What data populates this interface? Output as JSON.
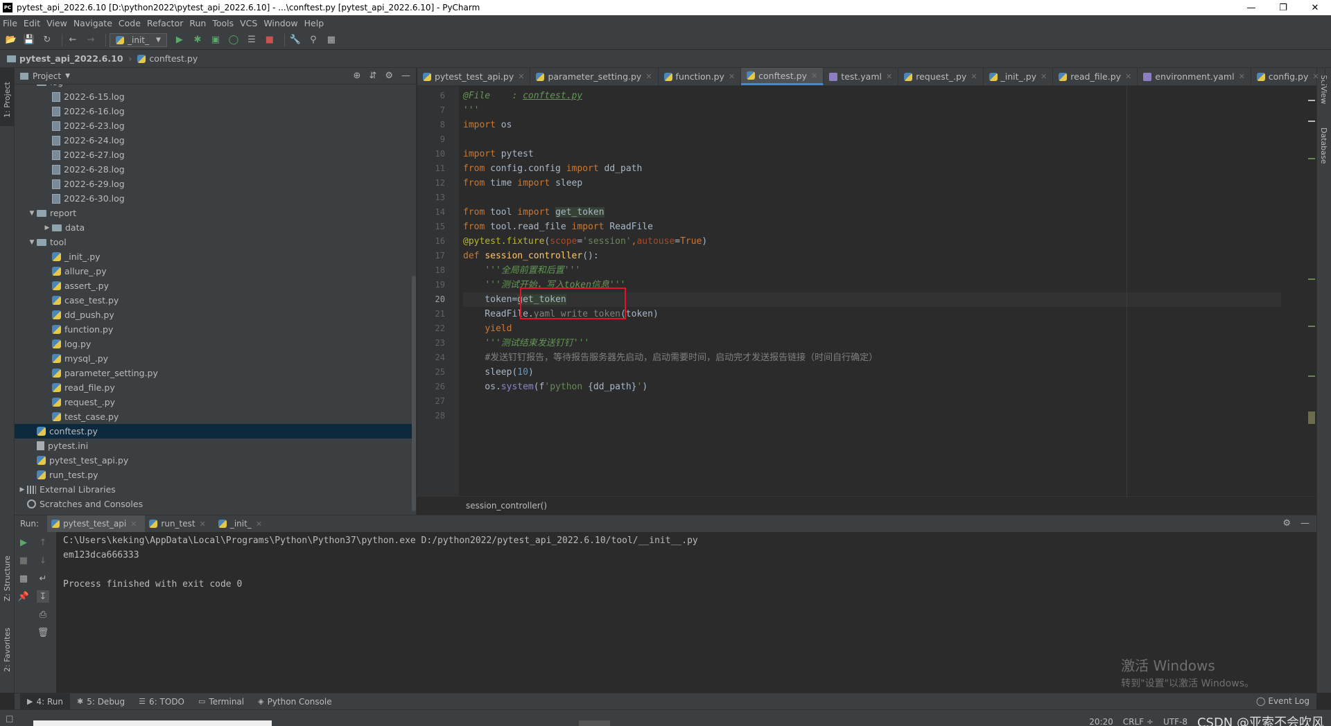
{
  "window": {
    "title": "pytest_api_2022.6.10 [D:\\python2022\\pytest_api_2022.6.10] - ...\\conftest.py [pytest_api_2022.6.10] - PyCharm",
    "logo": "PC",
    "controls": [
      "minimize-icon",
      "maximize-icon",
      "close-icon"
    ]
  },
  "menu": {
    "items": [
      "File",
      "Edit",
      "View",
      "Navigate",
      "Code",
      "Refactor",
      "Run",
      "Tools",
      "VCS",
      "Window",
      "Help"
    ]
  },
  "toolbar": {
    "run_config": "_init_",
    "icons": [
      "open-icon",
      "save-icon",
      "sync-icon",
      "back-icon",
      "forward-icon",
      "run-icon",
      "debug-icon",
      "coverage-icon",
      "profile-icon",
      "concurrency-icon",
      "stop-icon",
      "wrench-icon",
      "search-icon",
      "vcs-icon"
    ]
  },
  "navbar": {
    "project": "pytest_api_2022.6.10",
    "file": "conftest.py"
  },
  "left_strip": {
    "project": "1: Project",
    "structure": "Z: Structure",
    "favorites": "2: Favorites"
  },
  "right_strip": {
    "sciview": "SciView",
    "database": "Database"
  },
  "project_panel": {
    "title": "Project",
    "tree": [
      {
        "depth": 1,
        "arrow": "v",
        "icon": "folder",
        "label": "log"
      },
      {
        "depth": 2,
        "arrow": "",
        "icon": "log",
        "label": "2022-6-15.log"
      },
      {
        "depth": 2,
        "arrow": "",
        "icon": "log",
        "label": "2022-6-16.log"
      },
      {
        "depth": 2,
        "arrow": "",
        "icon": "log",
        "label": "2022-6-23.log"
      },
      {
        "depth": 2,
        "arrow": "",
        "icon": "log",
        "label": "2022-6-24.log"
      },
      {
        "depth": 2,
        "arrow": "",
        "icon": "log",
        "label": "2022-6-27.log"
      },
      {
        "depth": 2,
        "arrow": "",
        "icon": "log",
        "label": "2022-6-28.log"
      },
      {
        "depth": 2,
        "arrow": "",
        "icon": "log",
        "label": "2022-6-29.log"
      },
      {
        "depth": 2,
        "arrow": "",
        "icon": "log",
        "label": "2022-6-30.log"
      },
      {
        "depth": 1,
        "arrow": "v",
        "icon": "folder",
        "label": "report"
      },
      {
        "depth": 2,
        "arrow": ">",
        "icon": "folder",
        "label": "data"
      },
      {
        "depth": 1,
        "arrow": "v",
        "icon": "folder",
        "label": "tool"
      },
      {
        "depth": 2,
        "arrow": "",
        "icon": "py",
        "label": "_init_.py"
      },
      {
        "depth": 2,
        "arrow": "",
        "icon": "py",
        "label": "allure_.py"
      },
      {
        "depth": 2,
        "arrow": "",
        "icon": "py",
        "label": "assert_.py"
      },
      {
        "depth": 2,
        "arrow": "",
        "icon": "py",
        "label": "case_test.py"
      },
      {
        "depth": 2,
        "arrow": "",
        "icon": "py",
        "label": "dd_push.py"
      },
      {
        "depth": 2,
        "arrow": "",
        "icon": "py",
        "label": "function.py"
      },
      {
        "depth": 2,
        "arrow": "",
        "icon": "py",
        "label": "log.py"
      },
      {
        "depth": 2,
        "arrow": "",
        "icon": "py",
        "label": "mysql_.py"
      },
      {
        "depth": 2,
        "arrow": "",
        "icon": "py",
        "label": "parameter_setting.py"
      },
      {
        "depth": 2,
        "arrow": "",
        "icon": "py",
        "label": "read_file.py"
      },
      {
        "depth": 2,
        "arrow": "",
        "icon": "py",
        "label": "request_.py"
      },
      {
        "depth": 2,
        "arrow": "",
        "icon": "py",
        "label": "test_case.py"
      },
      {
        "depth": 1,
        "arrow": "",
        "icon": "py",
        "label": "conftest.py",
        "selected": true
      },
      {
        "depth": 1,
        "arrow": "",
        "icon": "file",
        "label": "pytest.ini"
      },
      {
        "depth": 1,
        "arrow": "",
        "icon": "py",
        "label": "pytest_test_api.py"
      },
      {
        "depth": 1,
        "arrow": "",
        "icon": "py",
        "label": "run_test.py"
      },
      {
        "depth": 0,
        "arrow": ">",
        "icon": "lib",
        "label": "External Libraries"
      },
      {
        "depth": 0,
        "arrow": "",
        "icon": "scratch",
        "label": "Scratches and Consoles"
      }
    ]
  },
  "editor": {
    "tabs": [
      {
        "label": "pytest_test_api.py",
        "icon": "py"
      },
      {
        "label": "parameter_setting.py",
        "icon": "py"
      },
      {
        "label": "function.py",
        "icon": "py"
      },
      {
        "label": "conftest.py",
        "icon": "py",
        "active": true
      },
      {
        "label": "test.yaml",
        "icon": "yaml"
      },
      {
        "label": "request_.py",
        "icon": "py"
      },
      {
        "label": "_init_.py",
        "icon": "py"
      },
      {
        "label": "read_file.py",
        "icon": "py"
      },
      {
        "label": "environment.yaml",
        "icon": "yaml"
      },
      {
        "label": "config.py",
        "icon": "py"
      }
    ],
    "line_numbers": [
      "6",
      "7",
      "8",
      "9",
      "10",
      "11",
      "12",
      "13",
      "14",
      "15",
      "16",
      "17",
      "18",
      "19",
      "20",
      "21",
      "22",
      "23",
      "24",
      "25",
      "26",
      "27",
      "28"
    ],
    "current_line": "20",
    "code_lines": [
      [
        {
          "t": "doc",
          "v": "@File    : "
        },
        {
          "t": "doclink",
          "v": "conftest.py"
        }
      ],
      [
        {
          "t": "doc",
          "v": "'''"
        }
      ],
      [
        {
          "t": "kw",
          "v": "import "
        },
        {
          "t": "",
          "v": "os"
        }
      ],
      [],
      [
        {
          "t": "kw",
          "v": "import "
        },
        {
          "t": "",
          "v": "pytest"
        }
      ],
      [
        {
          "t": "kw",
          "v": "from "
        },
        {
          "t": "",
          "v": "config.config "
        },
        {
          "t": "kw",
          "v": "import "
        },
        {
          "t": "",
          "v": "dd_path"
        }
      ],
      [
        {
          "t": "kw",
          "v": "from "
        },
        {
          "t": "",
          "v": "time "
        },
        {
          "t": "kw",
          "v": "import "
        },
        {
          "t": "",
          "v": "sleep"
        }
      ],
      [],
      [
        {
          "t": "kw",
          "v": "from "
        },
        {
          "t": "",
          "v": "tool "
        },
        {
          "t": "kw",
          "v": "import "
        },
        {
          "t": "hl",
          "v": "get_token"
        }
      ],
      [
        {
          "t": "kw",
          "v": "from "
        },
        {
          "t": "",
          "v": "tool.read_file "
        },
        {
          "t": "kw",
          "v": "import "
        },
        {
          "t": "",
          "v": "ReadFile"
        }
      ],
      [
        {
          "t": "dec",
          "v": "@pytest.fixture"
        },
        {
          "t": "",
          "v": "("
        },
        {
          "t": "param",
          "v": "scope"
        },
        {
          "t": "",
          "v": "="
        },
        {
          "t": "str",
          "v": "'session'"
        },
        {
          "t": "kw",
          "v": ","
        },
        {
          "t": "param",
          "v": "autouse"
        },
        {
          "t": "",
          "v": "="
        },
        {
          "t": "kw",
          "v": "True"
        },
        {
          "t": "",
          "v": ")"
        }
      ],
      [
        {
          "t": "kw",
          "v": "def "
        },
        {
          "t": "fn",
          "v": "session_controller"
        },
        {
          "t": "",
          "v": "():"
        }
      ],
      [
        {
          "t": "",
          "v": "    "
        },
        {
          "t": "doc",
          "v": "'''全局前置和后置'''"
        }
      ],
      [
        {
          "t": "",
          "v": "    "
        },
        {
          "t": "doc",
          "v": "'''测试开始，写入token信息'''"
        }
      ],
      [
        {
          "t": "",
          "v": "    token="
        },
        {
          "t": "hl",
          "v": "get_token"
        }
      ],
      [
        {
          "t": "",
          "v": "    ReadFile."
        },
        {
          "t": "com",
          "v": "yaml_write_token"
        },
        {
          "t": "",
          "v": "(token)"
        }
      ],
      [
        {
          "t": "",
          "v": "    "
        },
        {
          "t": "kw",
          "v": "yield"
        }
      ],
      [
        {
          "t": "",
          "v": "    "
        },
        {
          "t": "doc",
          "v": "'''测试结束发送钉钉'''"
        }
      ],
      [
        {
          "t": "",
          "v": "    "
        },
        {
          "t": "com",
          "v": "#发送钉钉报告，等待报告服务器先启动，启动需要时间，启动完才发送报告链接（时间自行确定）"
        }
      ],
      [
        {
          "t": "",
          "v": "    sleep("
        },
        {
          "t": "num",
          "v": "10"
        },
        {
          "t": "",
          "v": ")"
        }
      ],
      [
        {
          "t": "",
          "v": "    os."
        },
        {
          "t": "bi",
          "v": "system"
        },
        {
          "t": "",
          "v": "(f"
        },
        {
          "t": "str",
          "v": "'python "
        },
        {
          "t": "",
          "v": "{dd_path}"
        },
        {
          "t": "str",
          "v": "'"
        },
        {
          "t": "",
          "v": ")"
        }
      ],
      [],
      []
    ],
    "breadcrumb": "session_controller()"
  },
  "run_panel": {
    "label": "Run:",
    "tabs": [
      {
        "label": "pytest_test_api",
        "active": true
      },
      {
        "label": "run_test"
      },
      {
        "label": "_init_"
      }
    ],
    "console": [
      "C:\\Users\\keking\\AppData\\Local\\Programs\\Python\\Python37\\python.exe D:/python2022/pytest_api_2022.6.10/tool/__init__.py",
      "em123dca666333",
      "",
      "Process finished with exit code 0"
    ],
    "watermark_title": "激活 Windows",
    "watermark_sub": "转到\"设置\"以激活 Windows。"
  },
  "bottom_tools": {
    "items": [
      {
        "label": "4: Run",
        "icon": "▶",
        "active": true
      },
      {
        "label": "5: Debug",
        "icon": "✱"
      },
      {
        "label": "6: TODO",
        "icon": "☰"
      },
      {
        "label": "Terminal",
        "icon": "▭"
      },
      {
        "label": "Python Console",
        "icon": "◈"
      }
    ],
    "event_log": "Event Log"
  },
  "statusbar": {
    "position": "20:20",
    "line_sep": "CRLF ÷",
    "encoding": "UTF-8",
    "watermark": "CSDN @亚索不会吹风"
  }
}
